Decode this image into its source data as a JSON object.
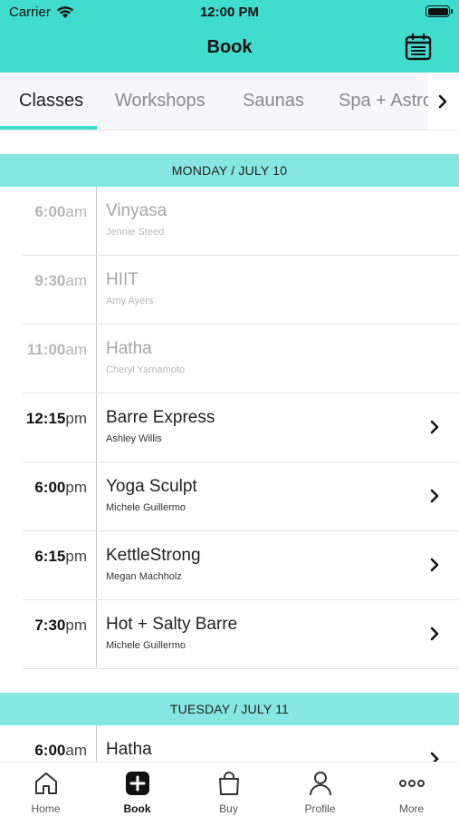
{
  "status_bar": {
    "carrier": "Carrier",
    "time": "12:00 PM"
  },
  "header": {
    "title": "Book"
  },
  "tabs": [
    {
      "label": "Classes",
      "active": true
    },
    {
      "label": "Workshops",
      "active": false
    },
    {
      "label": "Saunas",
      "active": false
    },
    {
      "label": "Spa + Astro",
      "active": false
    }
  ],
  "schedule": [
    {
      "day": "MONDAY / JULY 10",
      "classes": [
        {
          "time": "6:00",
          "ampm": "am",
          "name": "Vinyasa",
          "instructor": "Jennie Steed",
          "state": "past"
        },
        {
          "time": "9:30",
          "ampm": "am",
          "name": "HIIT",
          "instructor": "Amy Ayers",
          "state": "past"
        },
        {
          "time": "11:00",
          "ampm": "am",
          "name": "Hatha",
          "instructor": "Cheryl Yamamoto",
          "state": "past"
        },
        {
          "time": "12:15",
          "ampm": "pm",
          "name": "Barre Express",
          "instructor": "Ashley Willis",
          "state": "bookable"
        },
        {
          "time": "6:00",
          "ampm": "pm",
          "name": "Yoga Sculpt",
          "instructor": "Michele Guillermo",
          "state": "bookable"
        },
        {
          "time": "6:15",
          "ampm": "pm",
          "name": "KettleStrong",
          "instructor": "Megan Machholz",
          "state": "bookable"
        },
        {
          "time": "7:30",
          "ampm": "pm",
          "name": "Hot + Salty Barre",
          "instructor": "Michele Guillermo",
          "state": "bookable"
        }
      ]
    },
    {
      "day": "TUESDAY / JULY 11",
      "classes": [
        {
          "time": "6:00",
          "ampm": "am",
          "name": "Hatha",
          "instructor": "",
          "state": "bookable"
        }
      ]
    }
  ],
  "tab_bar": [
    {
      "label": "Home",
      "icon": "home-icon",
      "active": false
    },
    {
      "label": "Book",
      "icon": "plus-square-icon",
      "active": true
    },
    {
      "label": "Buy",
      "icon": "shopping-bag-icon",
      "active": false
    },
    {
      "label": "Profile",
      "icon": "person-icon",
      "active": false
    },
    {
      "label": "More",
      "icon": "more-dots-icon",
      "active": false
    }
  ],
  "colors": {
    "accent": "#40ddcf",
    "day_header": "#86e6e2",
    "past_text": "#a6a6a6"
  }
}
